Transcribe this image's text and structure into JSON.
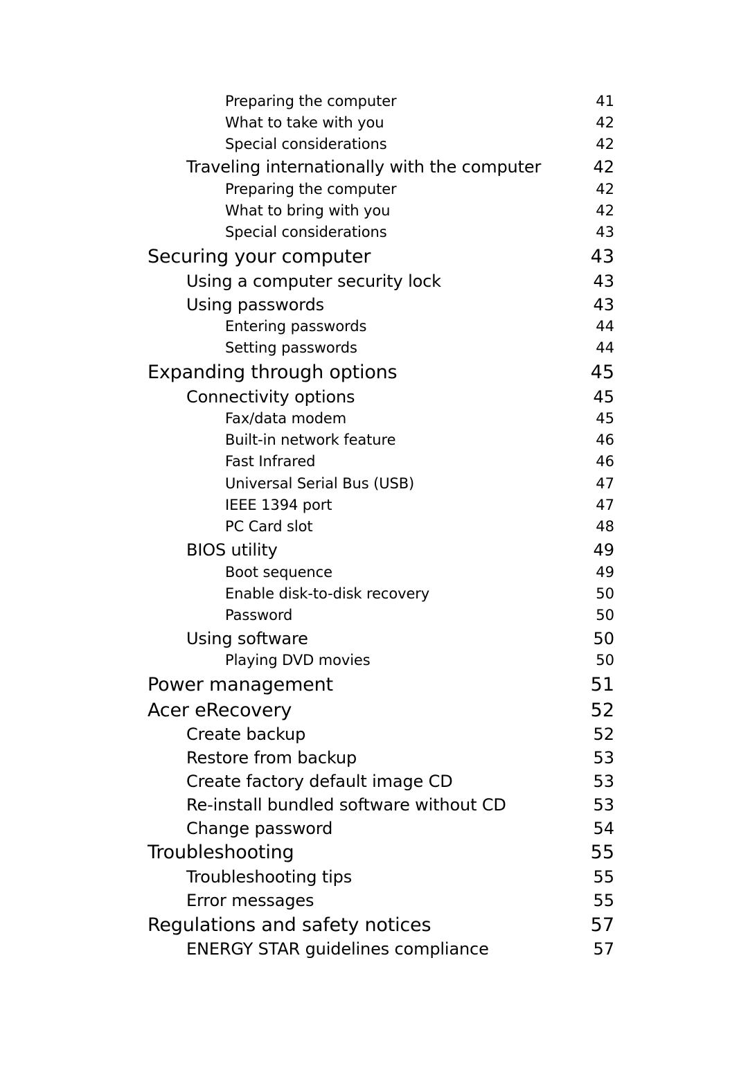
{
  "toc": {
    "entries": [
      {
        "level": 3,
        "title": "Preparing the computer",
        "page": "41"
      },
      {
        "level": 3,
        "title": "What to take with you",
        "page": "42"
      },
      {
        "level": 3,
        "title": "Special considerations",
        "page": "42"
      },
      {
        "level": 2,
        "title": "Traveling internationally with the computer",
        "page": "42"
      },
      {
        "level": 3,
        "title": "Preparing the computer",
        "page": "42"
      },
      {
        "level": 3,
        "title": "What to bring with you",
        "page": "42"
      },
      {
        "level": 3,
        "title": "Special considerations",
        "page": "43"
      },
      {
        "level": 1,
        "title": "Securing your computer",
        "page": "43"
      },
      {
        "level": 2,
        "title": "Using a computer security lock",
        "page": "43"
      },
      {
        "level": 2,
        "title": "Using passwords",
        "page": "43"
      },
      {
        "level": 3,
        "title": "Entering passwords",
        "page": "44"
      },
      {
        "level": 3,
        "title": "Setting passwords",
        "page": "44"
      },
      {
        "level": 1,
        "title": "Expanding through options",
        "page": "45"
      },
      {
        "level": 2,
        "title": "Connectivity options",
        "page": "45"
      },
      {
        "level": 3,
        "title": "Fax/data modem",
        "page": "45"
      },
      {
        "level": 3,
        "title": "Built-in network feature",
        "page": "46"
      },
      {
        "level": 3,
        "title": "Fast Infrared",
        "page": "46"
      },
      {
        "level": 3,
        "title": "Universal Serial Bus (USB)",
        "page": "47"
      },
      {
        "level": 3,
        "title": "IEEE 1394 port",
        "page": "47"
      },
      {
        "level": 3,
        "title": "PC Card slot",
        "page": "48"
      },
      {
        "level": 2,
        "title": "BIOS utility",
        "page": "49"
      },
      {
        "level": 3,
        "title": "Boot sequence",
        "page": "49"
      },
      {
        "level": 3,
        "title": "Enable disk-to-disk recovery",
        "page": "50"
      },
      {
        "level": 3,
        "title": "Password",
        "page": "50"
      },
      {
        "level": 2,
        "title": "Using software",
        "page": "50"
      },
      {
        "level": 3,
        "title": "Playing DVD movies",
        "page": "50"
      },
      {
        "level": 1,
        "title": "Power management",
        "page": "51"
      },
      {
        "level": 1,
        "title": "Acer eRecovery",
        "page": "52"
      },
      {
        "level": 2,
        "title": "Create backup",
        "page": "52"
      },
      {
        "level": 2,
        "title": "Restore from backup",
        "page": "53"
      },
      {
        "level": 2,
        "title": "Create factory default image CD",
        "page": "53"
      },
      {
        "level": 2,
        "title": "Re-install bundled software without CD",
        "page": "53"
      },
      {
        "level": 2,
        "title": "Change password",
        "page": "54"
      },
      {
        "level": 1,
        "title": "Troubleshooting",
        "page": "55"
      },
      {
        "level": 2,
        "title": "Troubleshooting tips",
        "page": "55"
      },
      {
        "level": 2,
        "title": "Error messages",
        "page": "55"
      },
      {
        "level": 1,
        "title": "Regulations and safety notices",
        "page": "57"
      },
      {
        "level": 2,
        "title": "ENERGY STAR guidelines compliance",
        "page": "57"
      }
    ]
  }
}
